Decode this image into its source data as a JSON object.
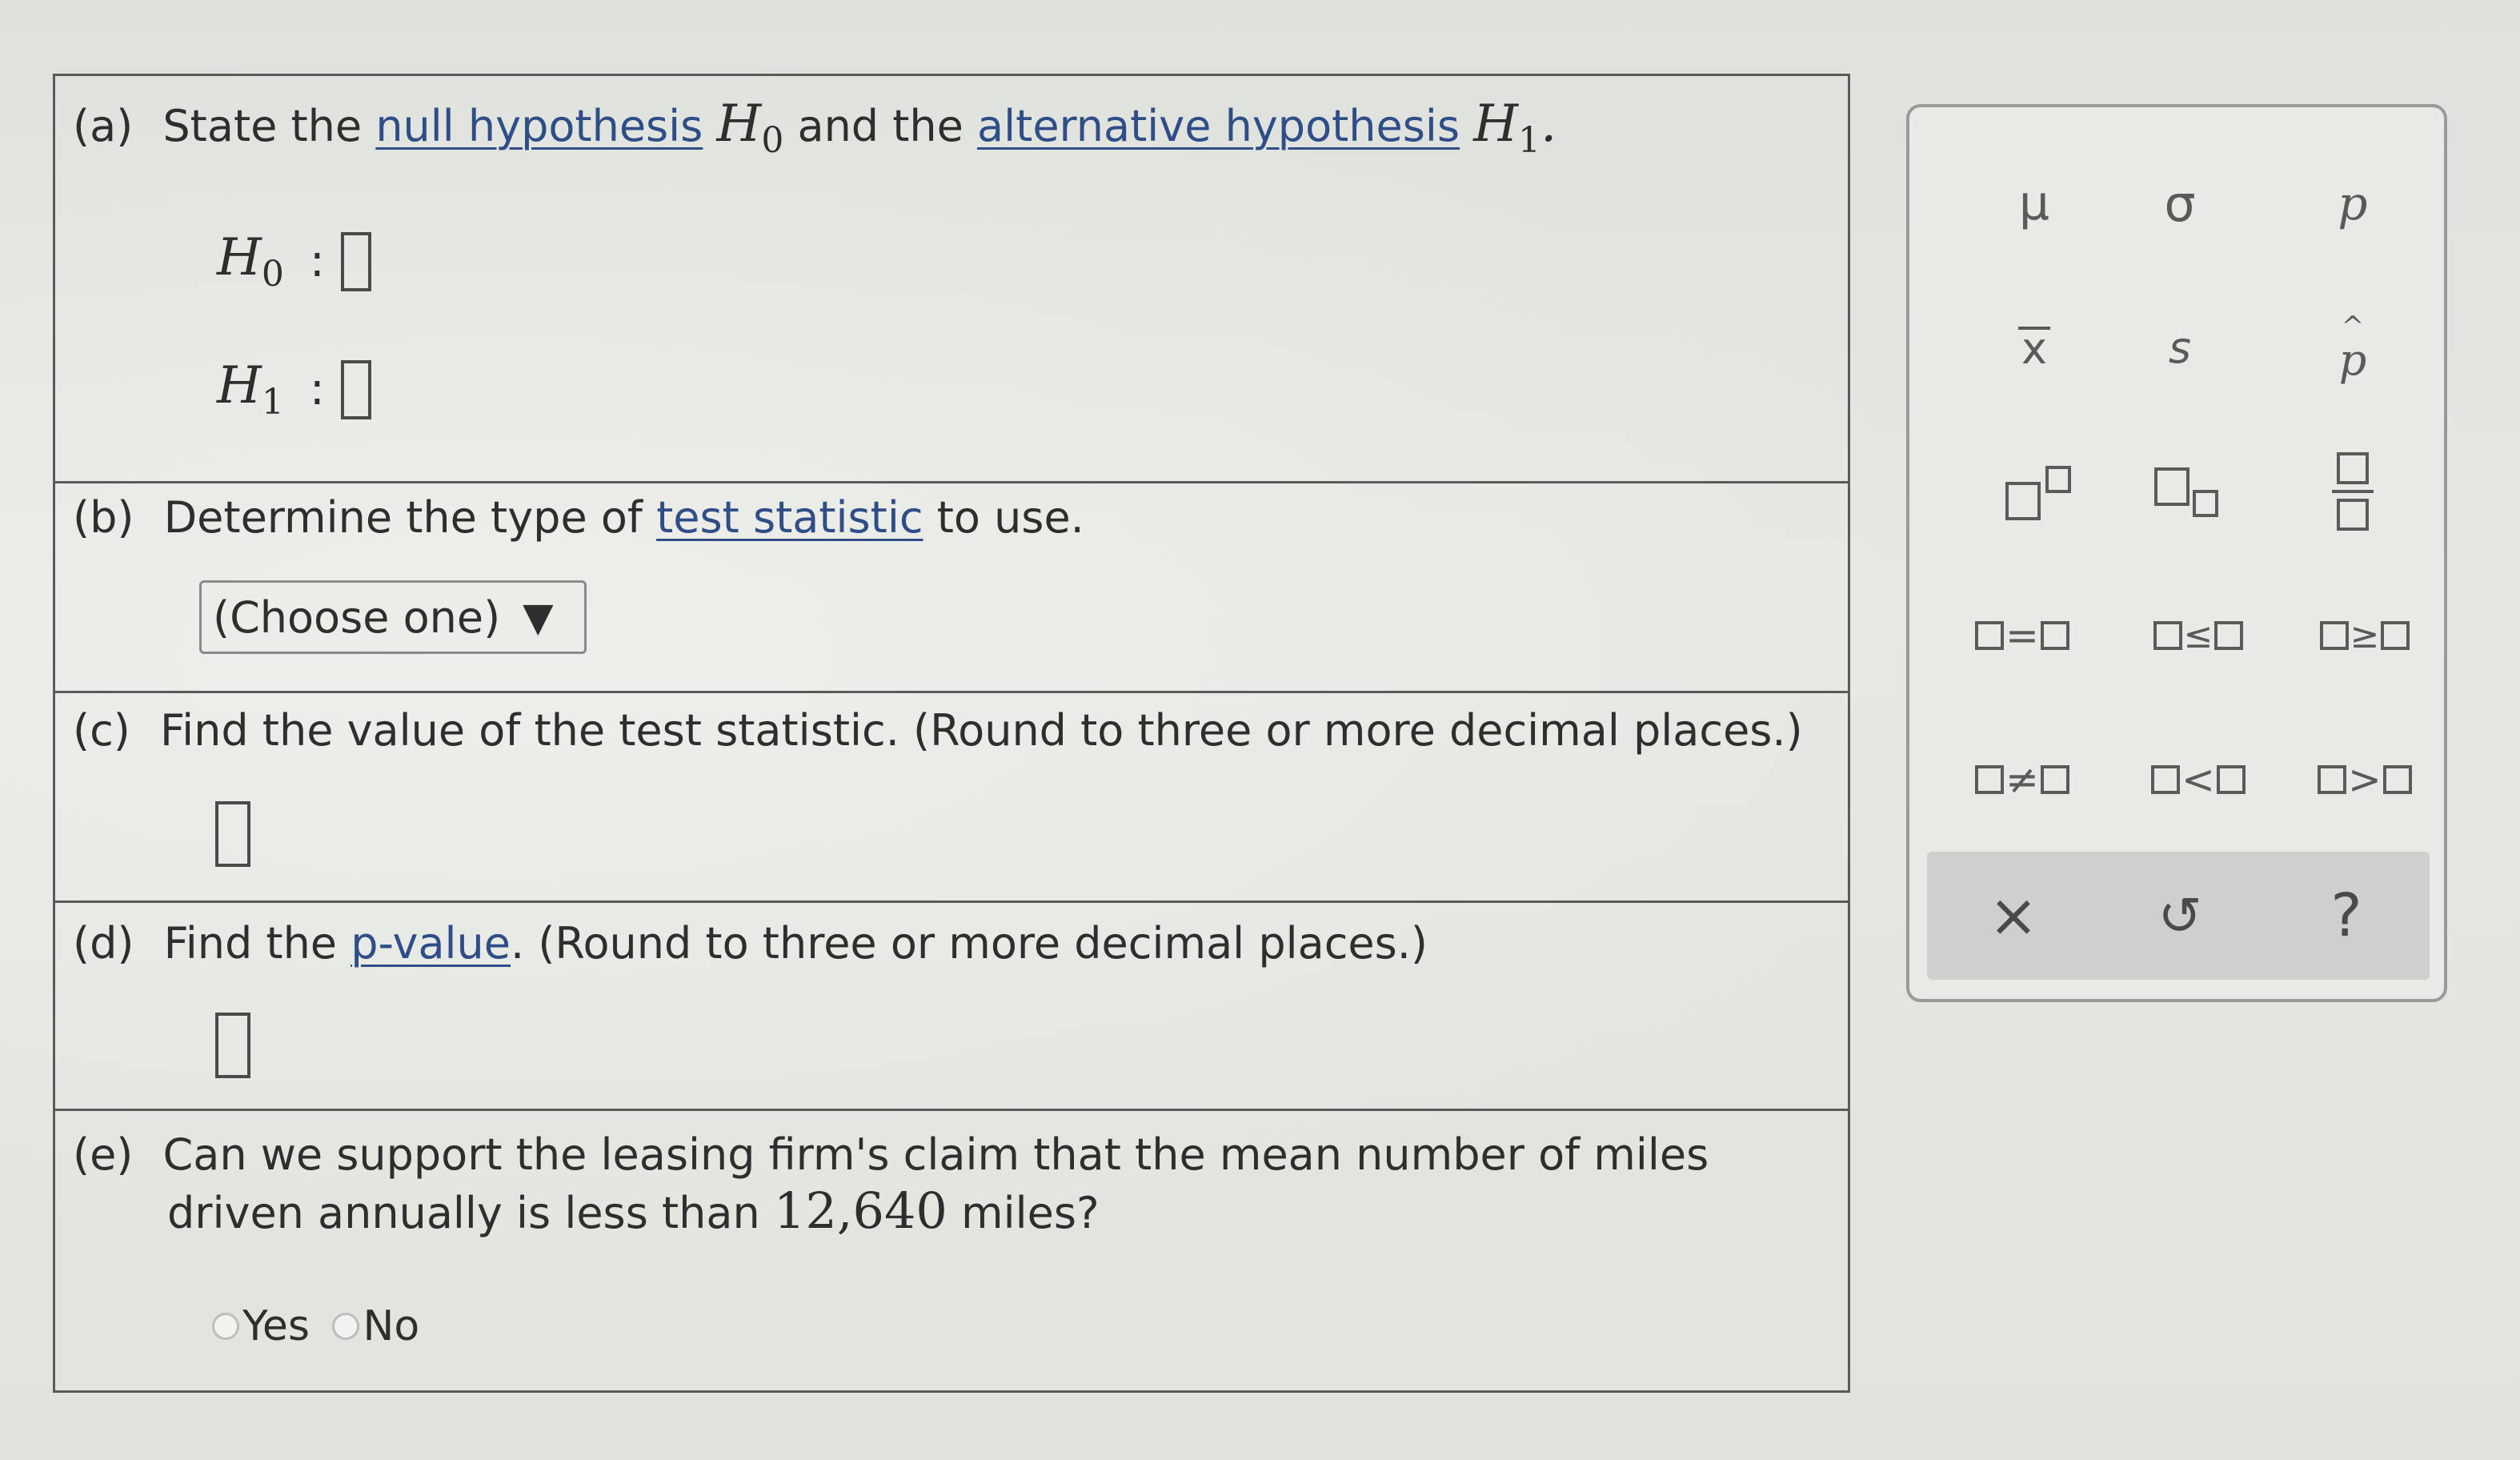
{
  "questions": {
    "a": {
      "tag": "(a)",
      "text1": "State the",
      "link1": "null hypothesis",
      "h0": "H",
      "h0_sub": "0",
      "text2": "and the",
      "link2": "alternative hypothesis",
      "h1": "H",
      "h1_sub": "1",
      "end": ".",
      "colon": ":"
    },
    "b": {
      "tag": "(b)",
      "text1": "Determine the type of",
      "link": "test statistic",
      "text2": "to use.",
      "select_value": "(Choose one)",
      "caret": "▼"
    },
    "c": {
      "tag": "(c)",
      "text": "Find the value of the test statistic. (Round to three or more decimal places.)"
    },
    "d": {
      "tag": "(d)",
      "text1": "Find the",
      "link": "p-value",
      "text2": ". (Round to three or more decimal places.)"
    },
    "e": {
      "tag": "(e)",
      "line1": "Can we support the leasing firm's claim that the mean number of miles",
      "line2a": "driven annually is less than",
      "number": "12,640",
      "line2b": "miles?",
      "options": [
        "Yes",
        "No"
      ]
    }
  },
  "palette": {
    "row1": [
      "μ",
      "σ",
      "p"
    ],
    "row2": [
      "x",
      "s",
      "p"
    ],
    "row4": [
      "=",
      "≤",
      "≥"
    ],
    "row5": [
      "≠",
      "<",
      ">"
    ],
    "actions": [
      "×",
      "↺",
      "?"
    ]
  },
  "icons": [
    "superscript-icon",
    "subscript-icon",
    "fraction-icon",
    "clear-icon",
    "undo-icon",
    "help-icon"
  ]
}
